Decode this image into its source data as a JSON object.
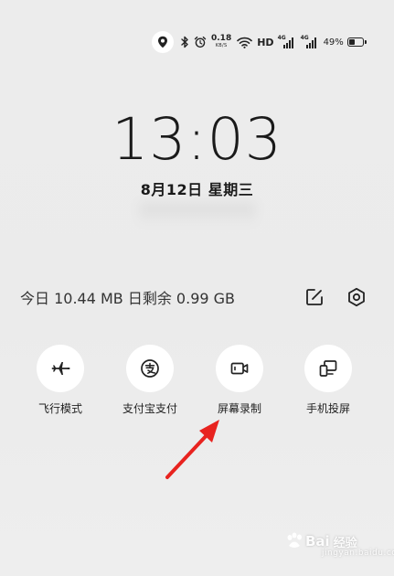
{
  "status_bar": {
    "speed_value": "0.18",
    "speed_unit": "KB/S",
    "hd": "HD",
    "net1": "4G",
    "net2": "4G",
    "battery_pct": "49%",
    "icons": [
      "location-icon",
      "bluetooth-icon",
      "alarm-icon",
      "wifi-icon",
      "battery-icon"
    ]
  },
  "lock": {
    "time": "13:03",
    "date": "8月12日  星期三"
  },
  "data_usage": {
    "text": "今日 10.44 MB  日剩余 0.99 GB",
    "edit_icon": "edit-icon",
    "settings_icon": "settings-icon"
  },
  "toggles": [
    {
      "label": "飞行模式",
      "icon": "airplane-icon"
    },
    {
      "label": "支付宝支付",
      "icon": "alipay-icon"
    },
    {
      "label": "屏幕录制",
      "icon": "screen-record-icon"
    },
    {
      "label": "手机投屏",
      "icon": "screen-cast-icon"
    }
  ],
  "annotation": {
    "arrow_color": "#e8231f"
  },
  "watermark": {
    "brand_a": "Bai",
    "brand_b": "经验",
    "domain": "jingyan.baidu.com"
  },
  "colors": {
    "background": "#ececec",
    "toggle_bg": "#ffffff",
    "text": "#222222"
  }
}
